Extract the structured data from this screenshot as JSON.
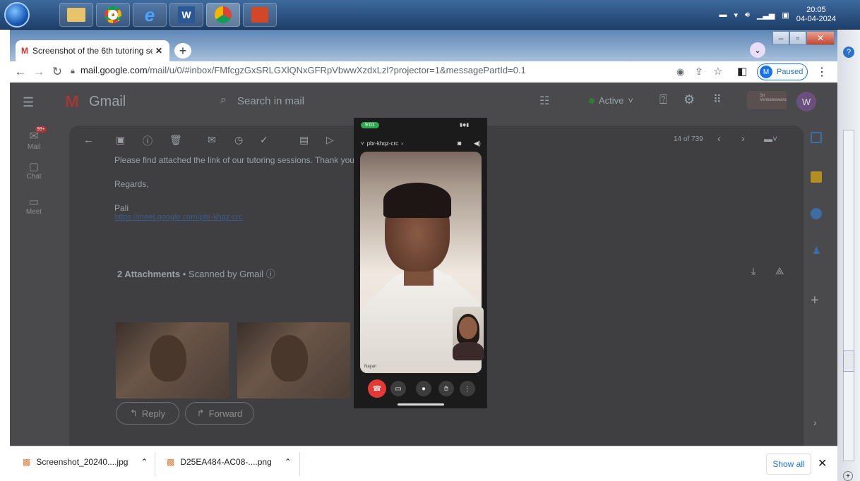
{
  "taskbar": {
    "apps": [
      "explorer-icon",
      "chrome-icon",
      "ie-icon",
      "word-icon",
      "chrome-meet-icon",
      "powerpoint-icon"
    ],
    "clock_time": "20:05",
    "clock_date": "04-04-2024"
  },
  "browser": {
    "tab_title": "Screenshot of the 6th tutoring se",
    "url_host": "mail.google.com",
    "url_path": "/mail/u/0/#inbox/FMfcgzGxSRLGXlQNxGFRpVbwwXzdxLzl?projector=1&messagePartId=0.1",
    "profile_label": "Paused",
    "profile_initial": "M"
  },
  "gmail": {
    "logo_text": "Gmail",
    "search_placeholder": "Search in mail",
    "status": "Active",
    "avatar_initial": "W",
    "org_name": "Sri Venkateswara",
    "rail": [
      "Mail",
      "Chat",
      "Meet"
    ],
    "mail_badge": "99+",
    "pager": "14 of 739",
    "body_line1": "Please find attached the link of our tutoring sessions. Thank you.",
    "regards": "Regards,",
    "sender": "Pali",
    "link": "https://meet.google.com/pbr-khqz-crc",
    "attachments_label": "2 Attachments",
    "scanned": "Scanned by Gmail",
    "reply": "Reply",
    "forward": "Forward"
  },
  "phone": {
    "time": "9:01",
    "meeting_code": "pbr-khqz-crc",
    "self_name": "Nayan"
  },
  "downloads": {
    "items": [
      "Screenshot_20240....jpg",
      "D25EA484-AC08-....png"
    ],
    "show_all": "Show all"
  }
}
